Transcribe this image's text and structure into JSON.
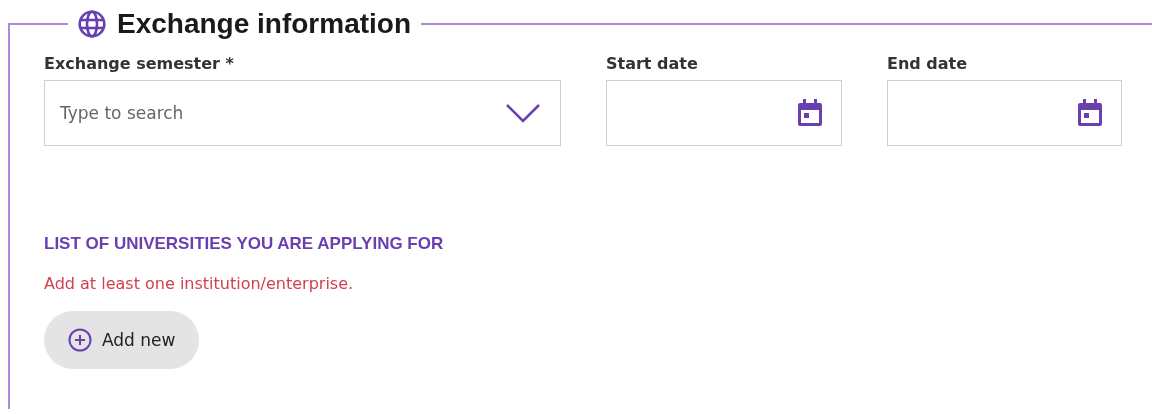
{
  "section": {
    "title": "Exchange information"
  },
  "fields": [
    {
      "kind": "select",
      "label": "Exchange semester *",
      "placeholder": "Type to search"
    },
    {
      "kind": "date",
      "label": "Start date"
    },
    {
      "kind": "date",
      "label": "End date"
    }
  ],
  "universities": {
    "heading": "LIST OF UNIVERSITIES YOU ARE APPLYING FOR",
    "error": "Add at least one institution/enterprise.",
    "add_button": "Add new"
  }
}
